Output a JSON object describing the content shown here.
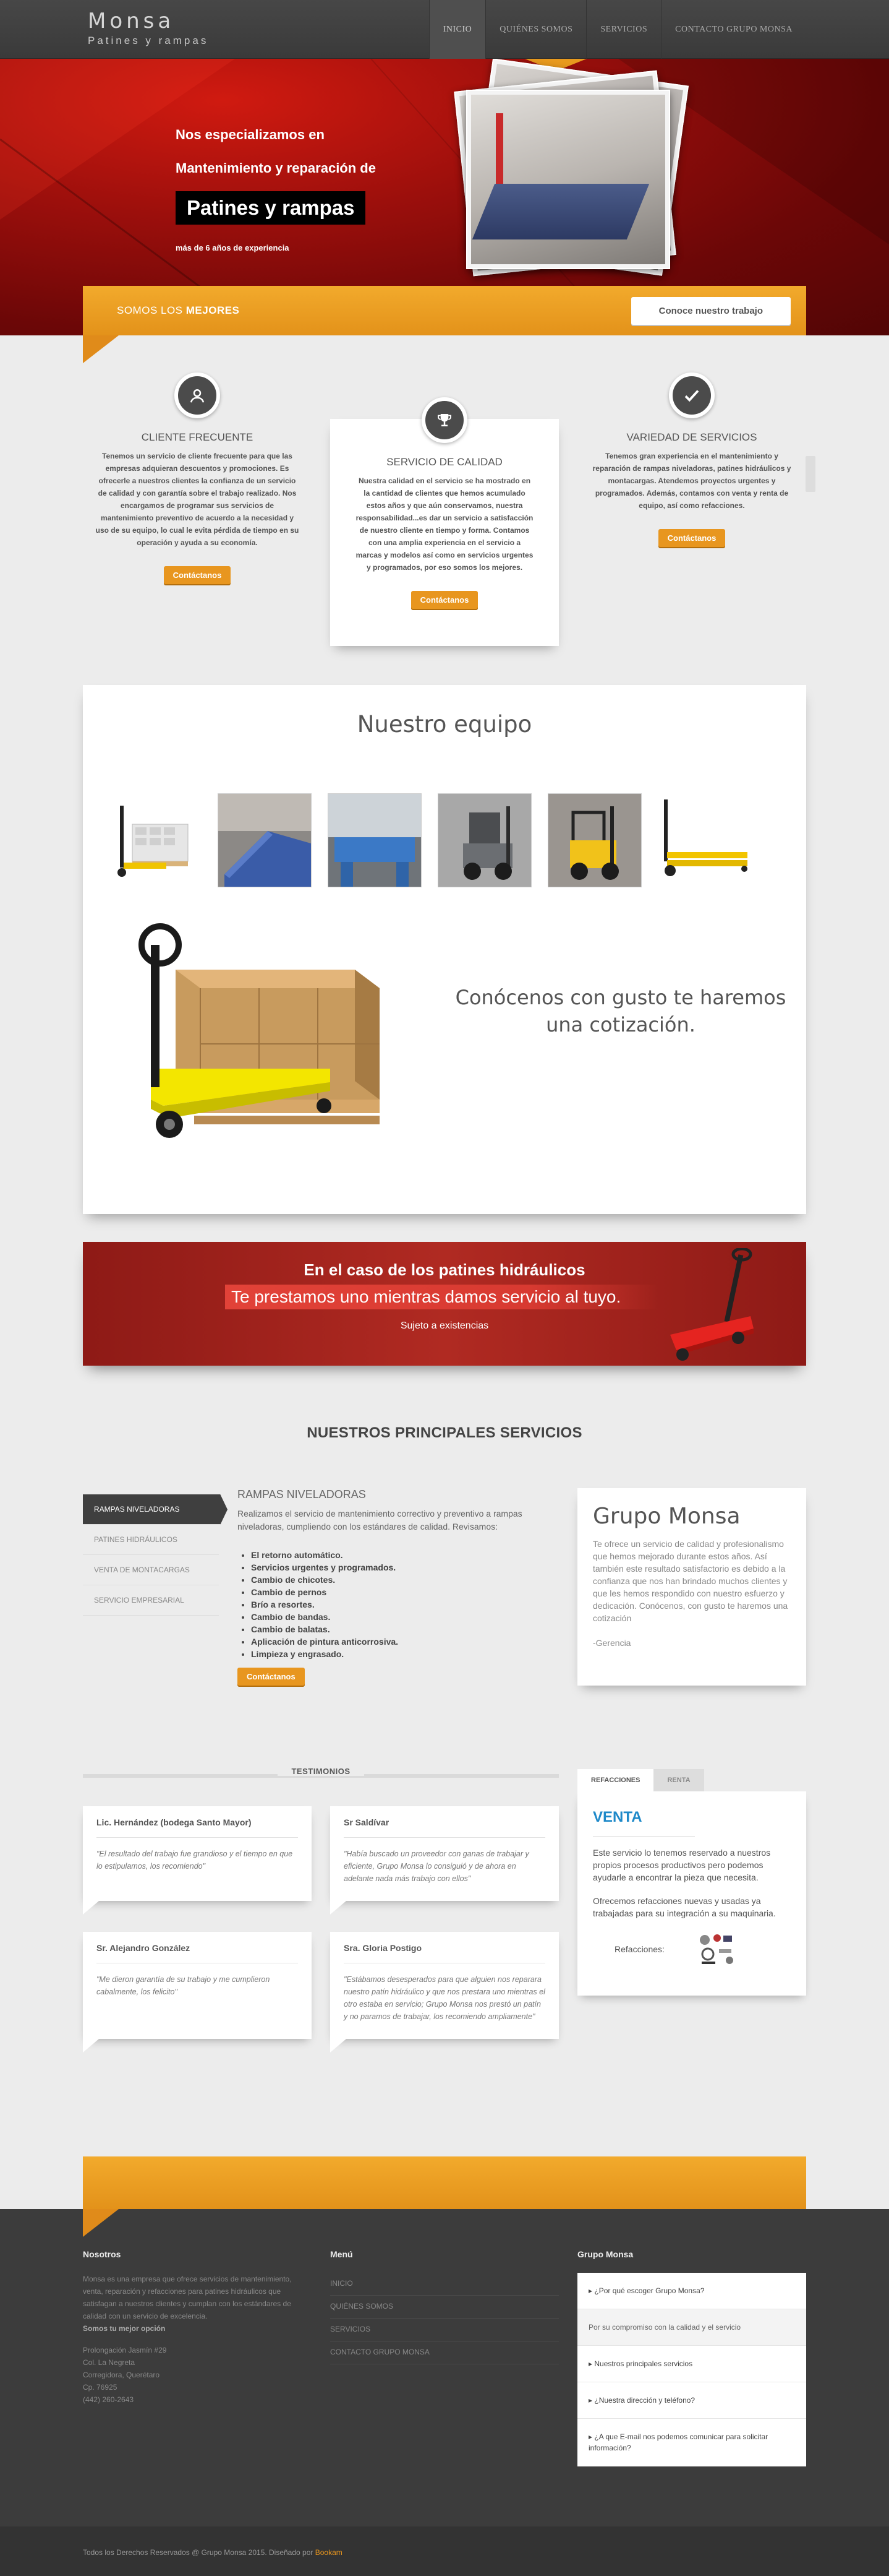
{
  "header": {
    "brand": "Monsa",
    "tagline": "Patines y rampas",
    "nav": [
      "INICIO",
      "QUIÉNES SOMOS",
      "SERVICIOS",
      "CONTACTO GRUPO MONSA"
    ]
  },
  "hero": {
    "line1": "Nos especializamos en",
    "line2": "Mantenimiento y reparación de",
    "highlight": "Patines y rampas",
    "sub": "más de 6 años de experiencia"
  },
  "banner": {
    "title_prefix": "SOMOS LOS",
    "title_bold": "MEJORES",
    "button": "Conoce nuestro trabajo"
  },
  "features": [
    {
      "icon": "user-icon",
      "title": "CLIENTE FRECUENTE",
      "text": "Tenemos un servicio de cliente frecuente para que las empresas adquieran descuentos y promociones. Es ofrecerle a nuestros clientes la confianza de un servicio de calidad y con garantía sobre el trabajo realizado. Nos encargamos de programar sus servicios de mantenimiento preventivo de acuerdo a la necesidad y uso de su equipo, lo cual le evita pérdida de tiempo en su operación y ayuda a su economía.",
      "button": "Contáctanos"
    },
    {
      "icon": "trophy-icon",
      "title": "SERVICIO DE CALIDAD",
      "text": "Nuestra calidad en el servicio se ha mostrado en la cantidad de clientes que hemos acumulado estos años y que aún conservamos, nuestra responsabilidad...es dar un servicio a satisfacción de nuestro cliente en tiempo y forma. Contamos con una amplia experiencia en el servicio a marcas y modelos así como en servicios urgentes y programados, por eso somos los mejores.",
      "button": "Contáctanos"
    },
    {
      "icon": "check-icon",
      "title": "VARIEDAD DE SERVICIOS",
      "text": "Tenemos gran experiencia en el mantenimiento y reparación de rampas niveladoras, patines hidráulicos y montacargas. Atendemos proyectos urgentes y programados. Además, contamos con venta y renta de equipo, así como refacciones.",
      "button": "Contáctanos"
    }
  ],
  "equipo": {
    "title": "Nuestro equipo",
    "message": "Conócenos con gusto te haremos una cotización."
  },
  "promo": {
    "line1": "En el caso de los patines hidráulicos",
    "line2": "Te prestamos uno mientras damos servicio al tuyo.",
    "line3": "Sujeto a existencias"
  },
  "servicios": {
    "title": "NUESTROS PRINCIPALES SERVICIOS",
    "tabs": [
      "RAMPAS NIVELADORAS",
      "PATINES HIDRÁULICOS",
      "VENTA DE MONTACARGAS",
      "SERVICIO EMPRESARIAL"
    ],
    "heading": "RAMPAS NIVELADORAS",
    "intro": "Realizamos el servicio de mantenimiento correctivo y preventivo a rampas niveladoras, cumpliendo con los estándares de calidad. Revisamos:",
    "list": [
      "El retorno automático.",
      "Servicios urgentes y programados.",
      "Cambio de chicotes.",
      "Cambio de pernos",
      "Brío a resortes.",
      "Cambio de bandas.",
      "Cambio de balatas.",
      "Aplicación de pintura anticorrosiva.",
      "Limpieza y engrasado."
    ],
    "button": "Contáctanos",
    "card": {
      "title": "Grupo Monsa",
      "text": "Te ofrece un servicio de calidad y profesionalismo que hemos mejorado durante estos años. Así también este resultado satisfactorio es debido a la confianza que nos han brindado muchos clientes y que les hemos respondido con nuestro esfuerzo y dedicación. Conócenos, con gusto te haremos una cotización",
      "signature": "-Gerencia"
    }
  },
  "testimonios": {
    "title": "TESTIMONIOS",
    "items": [
      {
        "name": "Lic. Hernández (bodega Santo Mayor)",
        "quote": "\"El resultado del trabajo fue grandioso y el tiempo en que lo estipulamos, los recomiendo\""
      },
      {
        "name": "Sr Saldívar",
        "quote": "\"Había buscado un proveedor con ganas de trabajar y eficiente, Grupo Monsa lo consiguió y de ahora en adelante nada más trabajo con ellos\""
      },
      {
        "name": "Sr. Alejandro González",
        "quote": "\"Me dieron garantía de su trabajo y me cumplieron cabalmente, los felicito\""
      },
      {
        "name": "Sra. Gloria Postigo",
        "quote": "\"Estábamos desesperados para que alguien nos reparara nuestro patín hidráulico y que nos prestara uno mientras el otro estaba en servicio; Grupo Monsa nos prestó un patín y no paramos de trabajar, los recomiendo ampliamente\""
      }
    ]
  },
  "side_tabs": {
    "tabs": [
      "REFACCIONES",
      "RENTA"
    ],
    "heading": "VENTA",
    "p1": "Este servicio lo tenemos reservado a nuestros propios procesos productivos pero podemos ayudarle a encontrar la pieza que necesita.",
    "p2": "Ofrecemos refacciones nuevas y usadas ya trabajadas para su integración a su maquinaria.",
    "label": "Refacciones:"
  },
  "footer": {
    "col1_title": "Nosotros",
    "about": "Monsa es una empresa que ofrece servicios de mantenimiento, venta, reparación y refacciones para patines hidráulicos que satisfagan a nuestros clientes y cumplan con los estándares de calidad con un servicio de excelencia.",
    "about_bold": "Somos tu mejor opción",
    "address": [
      "Prolongación Jasmín #29",
      "Col. La Negreta",
      "Corregidora, Querétaro",
      "Cp. 76925",
      "(442) 260-2643"
    ],
    "col2_title": "Menú",
    "menu": [
      "INICIO",
      "QUIÉNES SOMOS",
      "SERVICIOS",
      "CONTACTO GRUPO MONSA"
    ],
    "col3_title": "Grupo Monsa",
    "faq": [
      "¿Por qué escoger Grupo Monsa?",
      "Por su compromiso con la calidad y el servicio",
      "Nuestros principales servicios",
      "¿Nuestra dirección y teléfono?",
      "¿A que E-mail nos podemos comunicar para solicitar información?"
    ],
    "copyright": "Todos los Derechos Reservados @ Grupo Monsa 2015. Diseñado por",
    "designer": "Bookam"
  }
}
